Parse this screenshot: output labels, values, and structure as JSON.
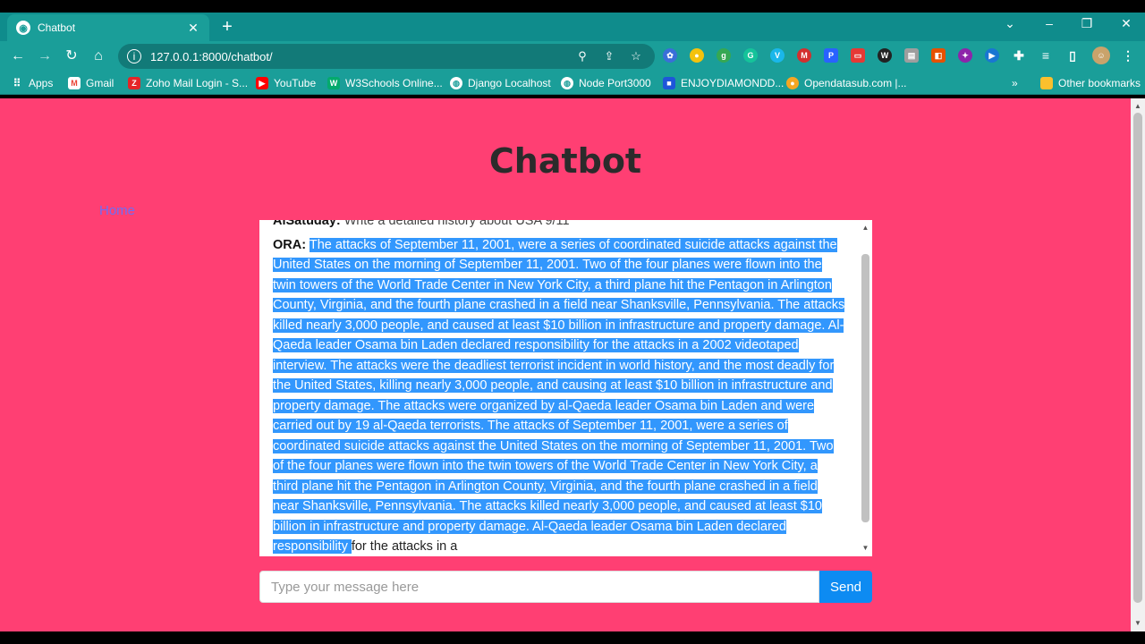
{
  "browser": {
    "tab_title": "Chatbot",
    "url": "127.0.0.1:8000/chatbot/",
    "bookmarks": [
      {
        "label": "Apps",
        "color": "#e8453c"
      },
      {
        "label": "Gmail",
        "color": "#ea4335"
      },
      {
        "label": "Zoho Mail Login - S...",
        "color": "#e42527"
      },
      {
        "label": "YouTube",
        "color": "#ff0000"
      },
      {
        "label": "W3Schools Online...",
        "color": "#04aa6d"
      },
      {
        "label": "Django Localhost",
        "color": "#ffffff"
      },
      {
        "label": "Node Port3000",
        "color": "#ffffff"
      },
      {
        "label": "ENJOYDIAMONDD...",
        "color": "#1e56d9"
      },
      {
        "label": "Opendatasub.com |...",
        "color": "#f5a623"
      }
    ],
    "other_bookmarks": "Other bookmarks"
  },
  "page": {
    "title": "Chatbot",
    "home_link": "Home"
  },
  "chat": {
    "user_name": "AlSatuday:",
    "user_message": "Write a detailed history about USA 9/11",
    "bot_name": "ORA:",
    "bot_message_selected": "The attacks of September 11, 2001, were a series of coordinated suicide attacks against the United States on the morning of September 11, 2001. Two of the four planes were flown into the twin towers of the World Trade Center in New York City, a third plane hit the Pentagon in Arlington County, Virginia, and the fourth plane crashed in a field near Shanksville, Pennsylvania. The attacks killed nearly 3,000 people, and caused at least $10 billion in infrastructure and property damage. Al-Qaeda leader Osama bin Laden declared responsibility for the attacks in a 2002 videotaped interview. The attacks were the deadliest terrorist incident in world history, and the most deadly for the United States, killing nearly 3,000 people, and causing at least $10 billion in infrastructure and property damage. The attacks were organized by al-Qaeda leader Osama bin Laden and were carried out by 19 al-Qaeda terrorists. The attacks of September 11, 2001, were a series of coordinated suicide attacks against the United States on the morning of September 11, 2001. Two of the four planes were flown into the twin towers of the World Trade Center in New York City, a third plane hit the Pentagon in Arlington County, Virginia, and the fourth plane crashed in a field near Shanksville, Pennsylvania. The attacks killed nearly 3,000 people, and caused at least $10 billion in infrastructure and property damage. Al-Qaeda leader Osama bin Laden declared responsibility ",
    "bot_message_rest": "for the attacks in a"
  },
  "input": {
    "placeholder": "Type your message here",
    "send_label": "Send"
  }
}
